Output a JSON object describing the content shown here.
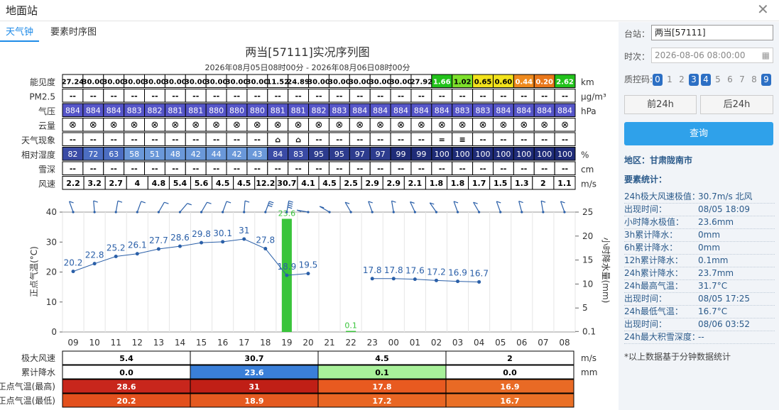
{
  "window": {
    "title": "地面站"
  },
  "tabs": [
    {
      "label": "天气钟"
    },
    {
      "label": "要素时序图"
    }
  ],
  "chart": {
    "title": "两当[57111]实况序列图",
    "subtitle": "2026年08月05日08时00分 - 2026年08月06日08时00分",
    "hours": [
      "09",
      "10",
      "11",
      "12",
      "13",
      "14",
      "15",
      "16",
      "17",
      "18",
      "19",
      "20",
      "21",
      "22",
      "23",
      "00",
      "01",
      "02",
      "03",
      "04",
      "05",
      "06",
      "07",
      "08"
    ],
    "rows": [
      {
        "label": "能见度",
        "unit": "km",
        "style": "vis",
        "values": [
          "27.24",
          "30.00",
          "30.00",
          "30.00",
          "30.00",
          "30.00",
          "30.00",
          "30.00",
          "30.00",
          "30.00",
          "11.52",
          "24.89",
          "30.00",
          "30.00",
          "30.00",
          "30.00",
          "30.00",
          "27.92",
          "1.66",
          "1.02",
          "0.65",
          "0.60",
          "0.44",
          "0.20",
          "2.62"
        ]
      },
      {
        "label": "PM2.5",
        "unit": "μg/m³",
        "style": "plain",
        "values": [
          "--",
          "--",
          "--",
          "--",
          "--",
          "--",
          "--",
          "--",
          "--",
          "--",
          "--",
          "--",
          "--",
          "--",
          "--",
          "--",
          "--",
          "--",
          "--",
          "--",
          "--",
          "--",
          "--",
          "--",
          "--"
        ]
      },
      {
        "label": "气压",
        "unit": "hPa",
        "style": "pres",
        "values": [
          "884",
          "884",
          "884",
          "883",
          "882",
          "881",
          "881",
          "880",
          "880",
          "880",
          "881",
          "881",
          "882",
          "883",
          "884",
          "884",
          "884",
          "884",
          "884",
          "883",
          "883",
          "884",
          "884",
          "884",
          "884"
        ]
      },
      {
        "label": "云量",
        "unit": "",
        "style": "cloud",
        "values": [
          "⊗",
          "⊗",
          "⊗",
          "⊗",
          "⊗",
          "⊗",
          "⊗",
          "⊗",
          "⊗",
          "⊗",
          "⊗",
          "⊗",
          "⊗",
          "⊗",
          "⊗",
          "⊗",
          "⊗",
          "⊗",
          "⊗",
          "⊗",
          "⊗",
          "⊗",
          "⊗",
          "⊗",
          "⊗"
        ]
      },
      {
        "label": "天气现象",
        "unit": "",
        "style": "wx",
        "values": [
          "--",
          "--",
          "--",
          "--",
          "--",
          "--",
          "--",
          "--",
          "--",
          "--",
          "rain",
          "rain",
          "--",
          "--",
          "--",
          "--",
          "--",
          "--",
          "=",
          "≡",
          "--",
          "--",
          "--",
          "--",
          "--"
        ]
      },
      {
        "label": "相对湿度",
        "unit": "%",
        "style": "rh",
        "values": [
          "82",
          "72",
          "63",
          "58",
          "51",
          "48",
          "42",
          "44",
          "42",
          "43",
          "84",
          "83",
          "95",
          "95",
          "97",
          "97",
          "99",
          "99",
          "100",
          "100",
          "100",
          "100",
          "100",
          "100",
          "100"
        ]
      },
      {
        "label": "雪深",
        "unit": "cm",
        "style": "plain",
        "values": [
          "--",
          "--",
          "--",
          "--",
          "--",
          "--",
          "--",
          "--",
          "--",
          "--",
          "--",
          "--",
          "--",
          "--",
          "--",
          "--",
          "--",
          "--",
          "--",
          "--",
          "--",
          "--",
          "--",
          "--",
          "--"
        ]
      },
      {
        "label": "风速",
        "unit": "m/s",
        "style": "plain",
        "values": [
          "2.2",
          "3.2",
          "2.7",
          "4",
          "4.8",
          "5.4",
          "5.6",
          "4.5",
          "4.5",
          "12.2",
          "30.7",
          "4.1",
          "4.5",
          "2.5",
          "2.9",
          "2.9",
          "2.1",
          "1.8",
          "1.8",
          "1.7",
          "1.5",
          "1.3",
          "2",
          "1.1"
        ]
      }
    ],
    "plot": {
      "left_axis": {
        "label": "正点气温(°C)",
        "ticks": [
          "0",
          "10",
          "20",
          "30",
          "40"
        ],
        "range": [
          0,
          40
        ]
      },
      "right_axis": {
        "label": "小时降水量(mm)",
        "ticks": [
          "0.1",
          "5",
          "10",
          "15",
          "20",
          "25"
        ]
      },
      "temperature": [
        20.2,
        22.8,
        25.2,
        26.1,
        27.7,
        28.6,
        29.8,
        30.1,
        31,
        27.8,
        18.9,
        19.5,
        null,
        null,
        17.8,
        17.8,
        17.6,
        17.2,
        16.9,
        16.7,
        null,
        null,
        null,
        null
      ],
      "temperature_labels": [
        "20.2",
        "22.8",
        "25.2",
        "26.1",
        "27.7",
        "28.6",
        "29.8",
        "30.1",
        "31",
        "27.8",
        "18.9",
        "19.5",
        "",
        "",
        "17.8",
        "17.8",
        "17.6",
        "17.2",
        "16.9",
        "16.7",
        "",
        "",
        "",
        ""
      ],
      "precip": [
        {
          "index": 10,
          "value": 23.6,
          "label": "23.6"
        },
        {
          "index": 13,
          "value": 0.1,
          "label": "0.1"
        }
      ],
      "wind_speed": [
        2.2,
        3.2,
        2.7,
        4,
        4.8,
        5.4,
        5.6,
        4.5,
        4.5,
        12.2,
        30.7,
        4.1,
        4.5,
        2.5,
        2.9,
        2.9,
        2.1,
        1.8,
        1.8,
        1.7,
        1.5,
        1.3,
        2,
        1.1
      ],
      "colors": {
        "temp_line": "#2a5fa8",
        "temp_label": "#2a5fa8",
        "rain": "#39c43b",
        "grid": "#e6e6e6"
      }
    },
    "summary": {
      "rows": [
        {
          "label": "极大风速",
          "unit": "m/s",
          "cells": [
            "5.4",
            "30.7",
            "4.5",
            "2"
          ],
          "colors": [
            "#ffffff",
            "#ffffff",
            "#ffffff",
            "#ffffff"
          ],
          "text": [
            "#000",
            "#000",
            "#000",
            "#000"
          ]
        },
        {
          "label": "累计降水",
          "unit": "mm",
          "cells": [
            "0.0",
            "23.6",
            "0.1",
            "0.0"
          ],
          "colors": [
            "#ffffff",
            "#3a7fd8",
            "#a8f09a",
            "#ffffff"
          ],
          "text": [
            "#000",
            "#fff",
            "#000",
            "#000"
          ]
        },
        {
          "label": "正点气温(最高)",
          "unit": "",
          "cells": [
            "28.6",
            "31",
            "17.8",
            "16.9"
          ],
          "colors": [
            "#c8261c",
            "#c01f16",
            "#e85a20",
            "#e96a25"
          ],
          "text": [
            "#fff",
            "#fff",
            "#fff",
            "#fff"
          ]
        },
        {
          "label": "正点气温(最低)",
          "unit": "",
          "cells": [
            "20.2",
            "18.9",
            "17.2",
            "16.7"
          ],
          "colors": [
            "#e3501d",
            "#e55a20",
            "#e96623",
            "#ea7026"
          ],
          "text": [
            "#fff",
            "#fff",
            "#fff",
            "#fff"
          ]
        }
      ]
    }
  },
  "sidebar": {
    "station_label": "台站：",
    "station_value": "两当[57111]",
    "time_label": "时次：",
    "time_value": "2026-08-06 08:00:00",
    "qc_label": "质控码:",
    "qc_codes": [
      {
        "v": "0",
        "on": true
      },
      {
        "v": "1",
        "on": false
      },
      {
        "v": "2",
        "on": false
      },
      {
        "v": "3",
        "on": true
      },
      {
        "v": "4",
        "on": true
      },
      {
        "v": "5",
        "on": false
      },
      {
        "v": "6",
        "on": false
      },
      {
        "v": "7",
        "on": false
      },
      {
        "v": "8",
        "on": false
      },
      {
        "v": "9",
        "on": true
      }
    ],
    "prev_btn": "前24h",
    "next_btn": "后24h",
    "query_btn": "查询",
    "region": "地区：甘肃陇南市",
    "stats_title": "要素统计：",
    "stats": [
      {
        "k": "24h极大风速极值：",
        "v": "30.7m/s 北风"
      },
      {
        "k": "出现时间：",
        "v": "08/05 18:09"
      },
      {
        "k": "小时降水极值：",
        "v": "23.6mm"
      },
      {
        "k": "3h累计降水：",
        "v": "0mm"
      },
      {
        "k": "6h累计降水：",
        "v": "0mm"
      },
      {
        "k": "12h累计降水：",
        "v": "0.1mm"
      },
      {
        "k": "24h累计降水：",
        "v": "23.7mm"
      },
      {
        "k": "24h最高气温：",
        "v": "31.7°C"
      },
      {
        "k": "出现时间：",
        "v": "08/05 17:25"
      },
      {
        "k": "24h最低气温：",
        "v": "16.7°C"
      },
      {
        "k": "出现时间：",
        "v": "08/06 03:52"
      },
      {
        "k": "24h最大积雪深度：",
        "v": "--"
      }
    ],
    "note": "*以上数据基于分钟数据统计"
  }
}
